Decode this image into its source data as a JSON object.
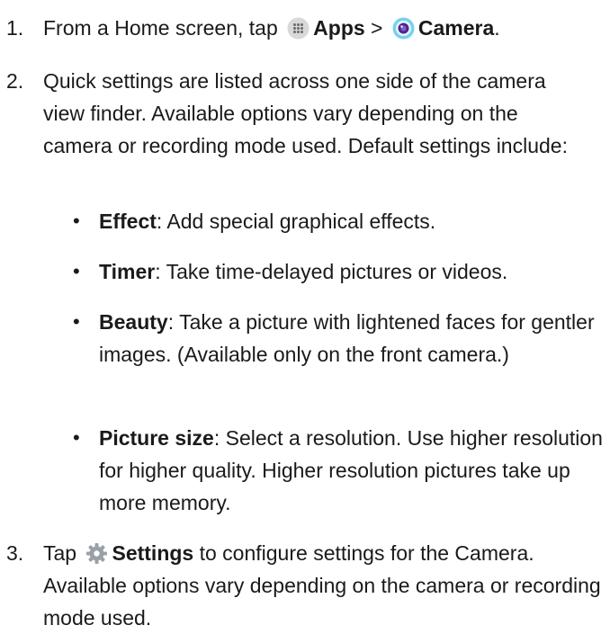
{
  "step1": {
    "number": "1.",
    "prefix": "From a Home screen, tap",
    "apps_icon": "apps-grid-icon",
    "apps_label": "Apps",
    "separator": ">",
    "camera_icon": "camera-lens-icon",
    "camera_label": "Camera",
    "suffix": "."
  },
  "step2": {
    "number": "2.",
    "text": "Quick settings are listed across one side of the camera view finder. Available options vary depending on the camera or recording mode used. Default settings include:",
    "bullets": [
      {
        "term": "Effect",
        "desc": ": Add special graphical effects."
      },
      {
        "term": "Timer",
        "desc": ": Take time-delayed pictures or videos."
      },
      {
        "term": "Beauty",
        "desc": ": Take a picture with lightened faces for gentler images. (Available only on the front camera.)"
      },
      {
        "term": "Picture size",
        "desc": ": Select a resolution. Use higher resolution for higher quality. Higher resolution pictures take up more memory."
      }
    ],
    "bullet_char": "•"
  },
  "step3": {
    "number": "3.",
    "prefix": "Tap",
    "settings_icon": "gear-icon",
    "settings_label": "Settings",
    "suffix": " to configure settings for the Camera. Available options vary depending on the camera or recording mode used."
  },
  "colors": {
    "text": "#1a1a1a",
    "apps_icon_bg": "#d8d8d8",
    "camera_ring": "#7ad0f0",
    "camera_lens": "#4a2a8a",
    "gear": "#9aa0a8"
  }
}
